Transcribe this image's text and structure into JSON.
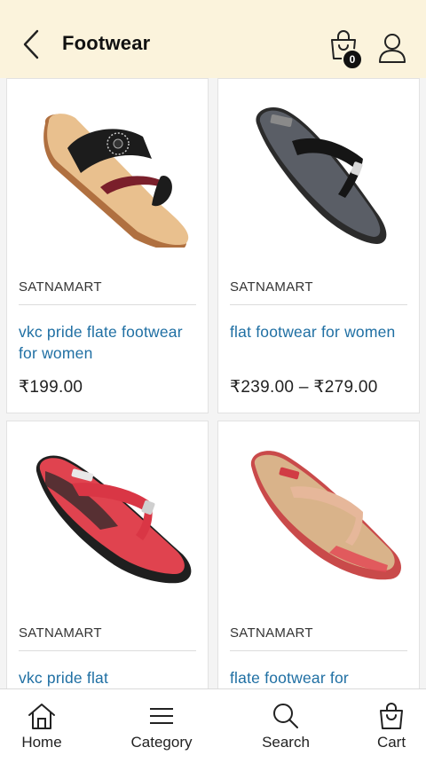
{
  "header": {
    "title": "Footwear",
    "cart_count": "0"
  },
  "products": [
    {
      "vendor": "SATNAMART",
      "name": "vkc pride flate footwear for women",
      "price": "₹199.00",
      "image": "black-maroon-toe-ring-sandal"
    },
    {
      "vendor": "SATNAMART",
      "name": "flat footwear for women",
      "price": "₹239.00 – ₹279.00",
      "image": "black-flip-flop"
    },
    {
      "vendor": "SATNAMART",
      "name": "vkc pride flat",
      "price": "",
      "image": "red-black-flip-flop"
    },
    {
      "vendor": "SATNAMART",
      "name": "flate footwear for",
      "price": "",
      "image": "red-cork-flip-flop"
    }
  ],
  "bottom_nav": [
    {
      "label": "Home",
      "icon": "home-icon"
    },
    {
      "label": "Category",
      "icon": "menu-icon"
    },
    {
      "label": "Search",
      "icon": "search-icon"
    },
    {
      "label": "Cart",
      "icon": "shopping-bag-icon"
    }
  ],
  "colors": {
    "header_bg": "#fbf3dc",
    "product_name": "#1f6fa3",
    "badge": "#111111"
  }
}
